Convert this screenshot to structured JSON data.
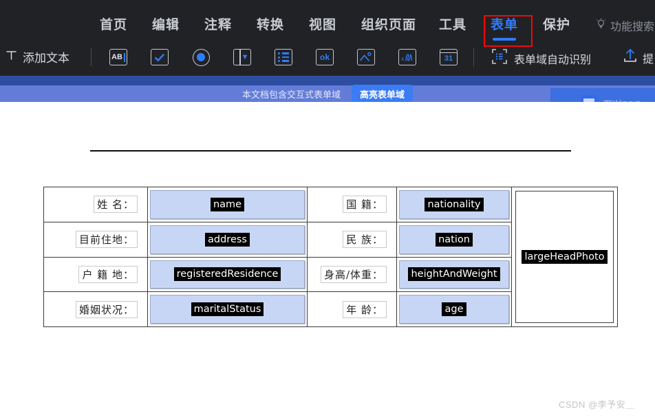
{
  "menubar": {
    "items": [
      {
        "label": "首页",
        "name": "menu-home",
        "active": false
      },
      {
        "label": "编辑",
        "name": "menu-edit",
        "active": false
      },
      {
        "label": "注释",
        "name": "menu-comment",
        "active": false
      },
      {
        "label": "转换",
        "name": "menu-convert",
        "active": false
      },
      {
        "label": "视图",
        "name": "menu-view",
        "active": false
      },
      {
        "label": "组织页面",
        "name": "menu-organize",
        "active": false
      },
      {
        "label": "工具",
        "name": "menu-tools",
        "active": false
      },
      {
        "label": "表单",
        "name": "menu-form",
        "active": true
      },
      {
        "label": "保护",
        "name": "menu-protect",
        "active": false
      }
    ],
    "feature_search": "功能搜索",
    "feature_search_icon": "lightbulb-icon",
    "active_accent": "#2f7dfa",
    "highlight_box_color": "#f00a0a"
  },
  "toolbar": {
    "add_text_label": "添加文本",
    "add_text_icon": "text-tool-icon",
    "field_tools": [
      {
        "name": "text-field-tool",
        "icon": "ab-textbox-icon",
        "label": "AB"
      },
      {
        "name": "checkbox-field-tool",
        "icon": "checkbox-icon",
        "label": "✓"
      },
      {
        "name": "radio-field-tool",
        "icon": "radio-button-icon",
        "label": ""
      },
      {
        "name": "combobox-field-tool",
        "icon": "combo-box-icon",
        "label": ""
      },
      {
        "name": "listbox-field-tool",
        "icon": "list-box-icon",
        "label": ""
      },
      {
        "name": "button-field-tool",
        "icon": "ok-button-icon",
        "label": "ok"
      },
      {
        "name": "image-field-tool",
        "icon": "image-field-icon",
        "label": ""
      },
      {
        "name": "signature-field-tool",
        "icon": "signature-icon",
        "label": ""
      },
      {
        "name": "date-field-tool",
        "icon": "calendar-icon",
        "label": "31"
      }
    ],
    "auto_recognize_label": "表单域自动识别",
    "auto_recognize_icon": "auto-detect-icon",
    "submit_label": "提",
    "submit_icon": "upload-arrow-icon"
  },
  "notice": {
    "message": "本文档包含交互式表单域",
    "button_label": "高亮表单域",
    "bar_color": "#627cd8",
    "button_color": "#3b7cf4"
  },
  "watermark": {
    "brand_text": "万兴PDF",
    "brand_icon": "wondershare-pdf-logo",
    "footer_text": "CSDN @李予安＿"
  },
  "document": {
    "table": {
      "rows": [
        {
          "label_left": "姓  名：",
          "field_left": "name",
          "label_right": "国  籍：",
          "field_right": "nationality"
        },
        {
          "label_left": "目前住地：",
          "field_left": "address",
          "label_right": "民  族：",
          "field_right": "nation"
        },
        {
          "label_left": "户 籍 地：",
          "field_left": "registeredResidence",
          "label_right": "身高/体重：",
          "field_right": "heightAndWeight"
        },
        {
          "label_left": "婚姻状况：",
          "field_left": "maritalStatus",
          "label_right": "年  龄：",
          "field_right": "age"
        }
      ],
      "photo_field": "largeHeadPhoto",
      "field_fill_color": "#c7d6f4",
      "field_tag_bg": "#000000"
    }
  }
}
